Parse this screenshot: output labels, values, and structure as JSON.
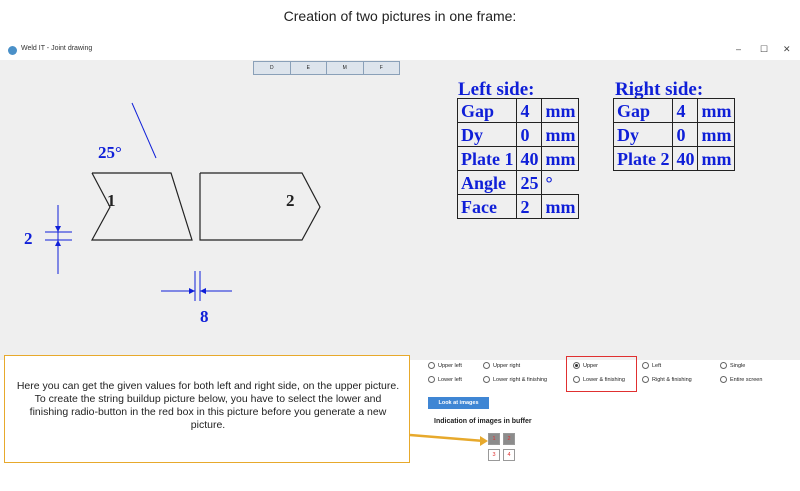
{
  "caption": "Creation of two pictures in one frame:",
  "window": {
    "title": "Weld IT - Joint drawing",
    "controls": {
      "minimize": "–",
      "maximize": "☐",
      "close": "✕"
    },
    "toolbar_buttons": [
      "D",
      "E",
      "M",
      "F"
    ]
  },
  "drawing": {
    "angle_label": "25°",
    "left_plate_label": "1",
    "right_plate_label": "2",
    "gap_dim_label": "2",
    "face_dim_label": "8",
    "line_color": "#0f1fd8"
  },
  "values": {
    "left_title": "Left side:",
    "right_title": "Right side:",
    "left_rows": [
      [
        "Gap",
        "4",
        "mm"
      ],
      [
        "Dy",
        "0",
        "mm"
      ],
      [
        "Plate 1",
        "40",
        "mm"
      ],
      [
        "Angle",
        "25",
        "°"
      ],
      [
        "Face",
        "2",
        "mm"
      ]
    ],
    "right_rows": [
      [
        "Gap",
        "4",
        "mm"
      ],
      [
        "Dy",
        "0",
        "mm"
      ],
      [
        "Plate 2",
        "40",
        "mm"
      ]
    ]
  },
  "options": {
    "radios": [
      {
        "label": "Upper left",
        "selected": false
      },
      {
        "label": "Upper right",
        "selected": false
      },
      {
        "label": "Upper",
        "selected": true
      },
      {
        "label": "Left",
        "selected": false
      },
      {
        "label": "Single",
        "selected": false
      },
      {
        "label": "Lower left",
        "selected": false
      },
      {
        "label": "Lower right & finishing",
        "selected": false
      },
      {
        "label": "Lower & finishing",
        "selected": false
      },
      {
        "label": "Right & finishing",
        "selected": false
      },
      {
        "label": "Entire screen",
        "selected": false
      }
    ],
    "look_button": "Look at images",
    "indication_label": "Indication of images in buffer",
    "buffer_cells": [
      "1",
      "2",
      "3",
      "4"
    ],
    "buffer_filled": [
      true,
      true,
      false,
      false
    ],
    "highlight_color": "#e03030"
  },
  "callout": {
    "text": "Here you can get the given values for both left and right side, on the upper picture. To create the string buildup picture below, you have to select the lower and finishing radio-button in the red box in this picture before you generate a new picture.",
    "border_color": "#e7a92c"
  }
}
